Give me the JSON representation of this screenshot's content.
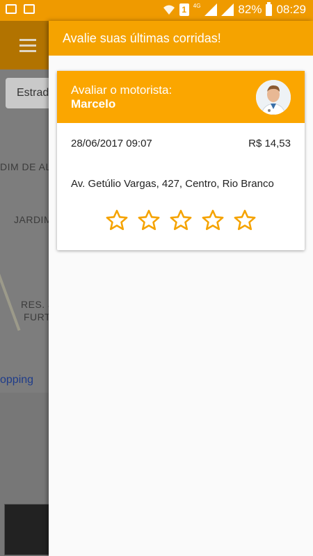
{
  "status_bar": {
    "sim_label": "1",
    "network_type": "4G",
    "battery": "82%",
    "time": "08:29",
    "color": "#ef9a00"
  },
  "map": {
    "search_text": "Estrad",
    "labels": [
      "DIM DE AL",
      "JARDIM",
      "RES. J",
      "FURT"
    ],
    "shopping_label": "opping"
  },
  "drawer": {
    "title": "Avalie suas últimas corridas!",
    "accent": "#f5a300"
  },
  "ride_card": {
    "heading": "Avaliar o motorista:",
    "driver_name": "Marcelo",
    "datetime": "28/06/2017 09:07",
    "price": "R$ 14,53",
    "address": "Av. Getúlio Vargas, 427, Centro, Rio Branco",
    "rating": 0,
    "max_rating": 5,
    "star_color": "#f5a300"
  }
}
